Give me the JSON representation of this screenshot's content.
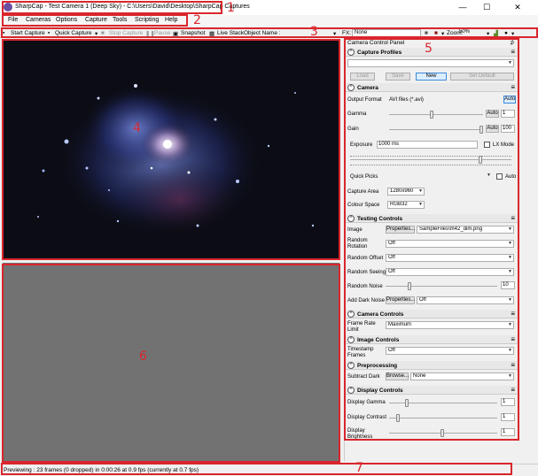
{
  "window": {
    "title": "SharpCap - Test Camera 1 (Deep Sky) - C:\\Users\\David\\Desktop\\SharpCap Captures",
    "minimize": "—",
    "maximize": "☐",
    "close": "✕"
  },
  "menu": [
    "File",
    "Cameras",
    "Options",
    "Capture",
    "Tools",
    "Scripting",
    "Help"
  ],
  "toolbar": {
    "start_capture": "Start Capture",
    "quick_capture": "Quick Capture",
    "stop_capture": "Stop Capture",
    "pause": "Pause",
    "snapshot": "Snapshot",
    "live_stack": "Live Stack",
    "object_name_label": "Object Name :",
    "fx_label": "FX:",
    "fx_value": "None",
    "zoom_label": "Zoom:",
    "zoom_value": "50%"
  },
  "panel": {
    "title": "Camera Control Panel",
    "pin": "⊅",
    "capture_profiles": {
      "heading": "Capture Profiles",
      "load": "Load",
      "save": "Save",
      "new": "New",
      "set_default": "Set Default"
    },
    "camera": {
      "heading": "Camera",
      "output_format_label": "Output Format",
      "output_format_value": "AVI files (*.avi)",
      "output_auto": "Auto",
      "gamma_label": "Gamma",
      "gamma_auto": "Auto",
      "gamma_value": "1",
      "gain_label": "Gain",
      "gain_auto": "Auto",
      "gain_value": "100",
      "exposure_label": "Exposure",
      "exposure_value": "1000 ms",
      "lx_mode": "LX Mode",
      "quick_picks_label": "Quick Picks",
      "quick_picks_auto": "Auto",
      "capture_area_label": "Capture Area",
      "capture_area_value": "1280x960",
      "colour_space_label": "Colour Space",
      "colour_space_value": "RGB32"
    },
    "testing": {
      "heading": "Testing Controls",
      "image_label": "Image",
      "image_button": "Properties...",
      "image_value": "SampleFiles\\m42_dim.png",
      "random_rotation_label": "Random Rotation",
      "random_rotation_value": "Off",
      "random_offset_label": "Random Offset",
      "random_offset_value": "Off",
      "random_seeing_label": "Random Seeing",
      "random_seeing_value": "Off",
      "random_noise_label": "Random Noise",
      "random_noise_value": "10",
      "dark_noise_label": "Add Dark Noise",
      "dark_noise_button": "Properties...",
      "dark_noise_value": "Off"
    },
    "camera_controls": {
      "heading": "Camera Controls",
      "frame_rate_label": "Frame Rate Limit",
      "frame_rate_value": "Maximum"
    },
    "image_controls": {
      "heading": "Image Controls",
      "timestamp_label": "Timestamp Frames",
      "timestamp_value": "Off"
    },
    "preprocessing": {
      "heading": "Preprocessing",
      "subtract_dark_label": "Subtract Dark",
      "browse": "Browse...",
      "subtract_dark_value": "None"
    },
    "display": {
      "heading": "Display Controls",
      "gamma_label": "Display Gamma",
      "gamma_value": "1",
      "contrast_label": "Display Contrast",
      "contrast_value": "1",
      "brightness_label": "Display Brightness",
      "brightness_value": "1"
    }
  },
  "status": "Previewing : 23 frames (0 dropped) in 0:00:26 at 0.9 fps  (currently at 0.7 fps)",
  "annotations": [
    "1",
    "2",
    "3",
    "4",
    "5",
    "6",
    "7"
  ],
  "colors": {
    "annotation": "#d9262c",
    "accent": "#3c8ad8"
  }
}
